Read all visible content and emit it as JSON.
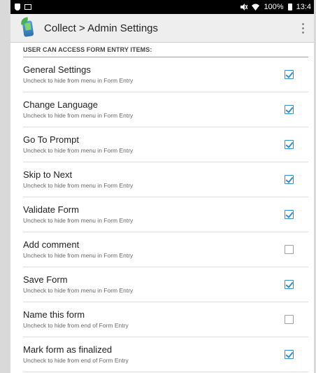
{
  "status_bar": {
    "battery_percent": "100%",
    "time": "13:4",
    "icons": [
      "shield-icon",
      "image-icon",
      "mute-icon",
      "wifi-icon",
      "battery-icon"
    ]
  },
  "app_bar": {
    "title": "Collect > Admin Settings",
    "logo_icon": "collect-app-icon",
    "overflow_icon": "overflow-menu-icon"
  },
  "section": {
    "header": "USER CAN ACCESS FORM ENTRY ITEMS:"
  },
  "items": [
    {
      "title": "General Settings",
      "subtitle": "Uncheck to hide from menu in Form Entry",
      "checked": true
    },
    {
      "title": "Change Language",
      "subtitle": "Uncheck to hide from menu in Form Entry",
      "checked": true
    },
    {
      "title": "Go To Prompt",
      "subtitle": "Uncheck to hide from menu in Form Entry",
      "checked": true
    },
    {
      "title": "Skip to Next",
      "subtitle": "Uncheck to hide from menu in Form Entry",
      "checked": true
    },
    {
      "title": "Validate Form",
      "subtitle": "Uncheck to hide from menu in Form Entry",
      "checked": true
    },
    {
      "title": "Add comment",
      "subtitle": "Uncheck to hide from menu in Form Entry",
      "checked": false
    },
    {
      "title": "Save Form",
      "subtitle": "Uncheck to hide from menu in Form Entry",
      "checked": true
    },
    {
      "title": "Name this form",
      "subtitle": "Uncheck to hide from end of Form Entry",
      "checked": false
    },
    {
      "title": "Mark form as finalized",
      "subtitle": "Uncheck to hide from end of Form Entry",
      "checked": true
    }
  ],
  "colors": {
    "accent": "#2f8fc8",
    "status_bar": "#000000",
    "app_bar": "#eeeeee"
  }
}
